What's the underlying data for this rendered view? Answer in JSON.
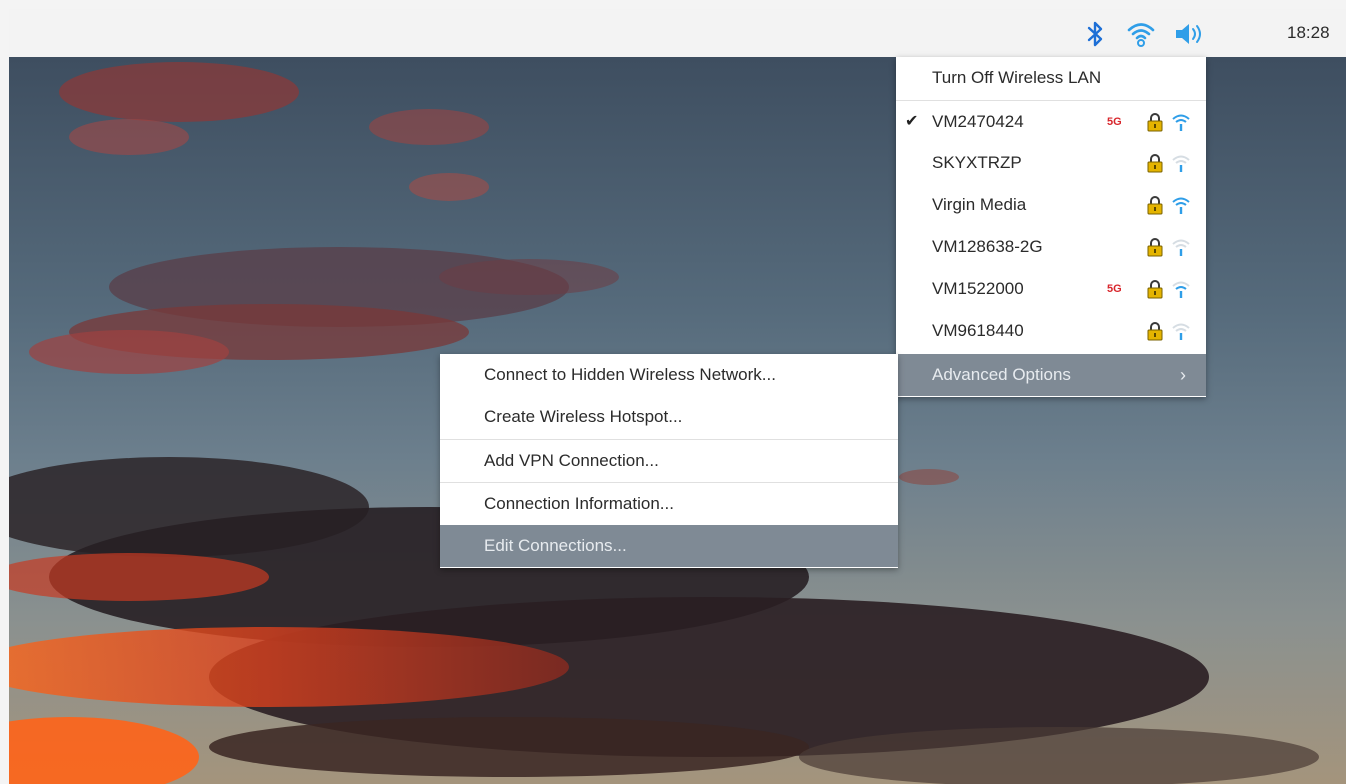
{
  "taskbar": {
    "icons": [
      "bluetooth-icon",
      "wifi-icon",
      "volume-icon"
    ],
    "clock": "18:28"
  },
  "wifi_menu": {
    "toggle_label": "Turn Off Wireless LAN",
    "networks": [
      {
        "ssid": "VM2470424",
        "connected": true,
        "band": "5G",
        "secured": true,
        "signal": "strong"
      },
      {
        "ssid": "SKYXTRZP",
        "connected": false,
        "band": "",
        "secured": true,
        "signal": "weak"
      },
      {
        "ssid": "Virgin Media",
        "connected": false,
        "band": "",
        "secured": true,
        "signal": "strong"
      },
      {
        "ssid": "VM128638-2G",
        "connected": false,
        "band": "",
        "secured": true,
        "signal": "weak"
      },
      {
        "ssid": "VM1522000",
        "connected": false,
        "band": "5G",
        "secured": true,
        "signal": "medium"
      },
      {
        "ssid": "VM9618440",
        "connected": false,
        "band": "",
        "secured": true,
        "signal": "weak"
      }
    ],
    "advanced_label": "Advanced Options",
    "check_glyph": "✔",
    "chevron_glyph": "›"
  },
  "advanced_menu": {
    "items": [
      "Connect to Hidden Wireless Network...",
      "Create Wireless Hotspot...",
      "Add VPN Connection...",
      "Connection Information...",
      "Edit Connections..."
    ],
    "highlighted_index": 4
  },
  "colors": {
    "taskbar_bg": "#f3f3f3",
    "bluetooth": "#1d6fd6",
    "wifi": "#2f9ee8",
    "badge_5g": "#d8262c",
    "lock": "#d9a800",
    "menu_highlight": "#7f8a95"
  }
}
